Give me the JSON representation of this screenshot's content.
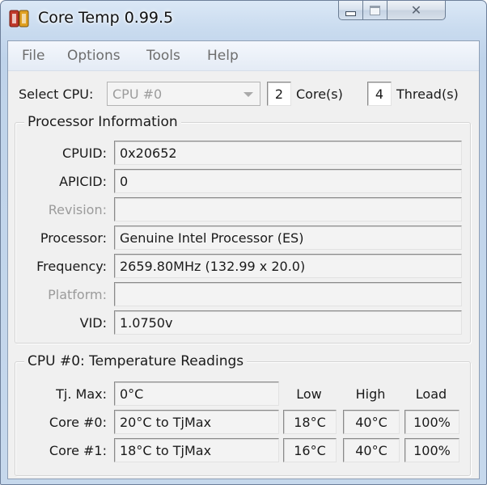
{
  "window": {
    "title": "Core Temp 0.99.5",
    "icon": "core-temp-app-icon",
    "controls": {
      "minimize": "minimize-icon",
      "maximize": "maximize-icon",
      "close": "✕"
    }
  },
  "menu": [
    "File",
    "Options",
    "Tools",
    "Help"
  ],
  "cpu_select": {
    "label": "Select CPU:",
    "value": "CPU #0",
    "cores_value": "2",
    "cores_label": "Core(s)",
    "threads_value": "4",
    "threads_label": "Thread(s)"
  },
  "processor_info": {
    "title": "Processor Information",
    "rows": [
      {
        "label": "CPUID:",
        "value": "0x20652",
        "enabled": true
      },
      {
        "label": "APICID:",
        "value": "0",
        "enabled": true
      },
      {
        "label": "Revision:",
        "value": "",
        "enabled": false
      },
      {
        "label": "Processor:",
        "value": "Genuine Intel Processor (ES)",
        "enabled": true
      },
      {
        "label": "Frequency:",
        "value": "2659.80MHz (132.99 x 20.0)",
        "enabled": true
      },
      {
        "label": "Platform:",
        "value": "",
        "enabled": false
      },
      {
        "label": "VID:",
        "value": "1.0750v",
        "enabled": true
      }
    ]
  },
  "temperatures": {
    "title": "CPU #0: Temperature Readings",
    "tjmax_label": "Tj. Max:",
    "tjmax_value": "0°C",
    "headers": [
      "Low",
      "High",
      "Load"
    ],
    "cores": [
      {
        "label": "Core #0:",
        "value": "20°C to TjMax",
        "low": "18°C",
        "high": "40°C",
        "load": "100%"
      },
      {
        "label": "Core #1:",
        "value": "18°C to TjMax",
        "low": "16°C",
        "high": "40°C",
        "load": "100%"
      }
    ]
  },
  "colors": {
    "frame": "#c6d8ec",
    "client": "#f0f0f0",
    "disabled_text": "#9b9b9b",
    "menu_text": "#6d6d6d"
  }
}
